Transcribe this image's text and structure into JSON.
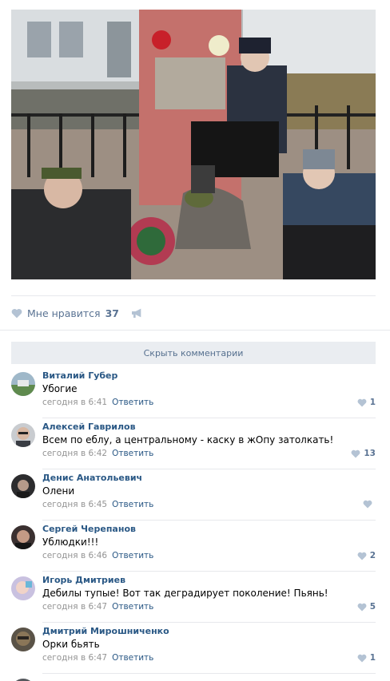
{
  "post": {
    "like_label": "Мне нравится",
    "like_count": "37",
    "hide_comments_label": "Скрыть комментарии"
  },
  "colors": {
    "link": "#2a5885",
    "muted": "#939393",
    "accent_soft": "#5a7393",
    "button_bg": "#eaedf1",
    "divider": "#e7e8ec"
  },
  "icons": {
    "like": "heart-icon",
    "share": "megaphone-icon",
    "comment_like": "heart-icon"
  },
  "comments": [
    {
      "author": "Виталий Губер",
      "text": "Убогие",
      "time": "сегодня в 6:41",
      "reply": "Ответить",
      "likes": "1"
    },
    {
      "author": "Алексей Гаврилов",
      "text": "Всем по еблу, а центральному - каску в жОпу затолкать!",
      "time": "сегодня в 6:42",
      "reply": "Ответить",
      "likes": "13"
    },
    {
      "author": "Денис Анатольевич",
      "text": "Олени",
      "time": "сегодня в 6:45",
      "reply": "Ответить",
      "likes": ""
    },
    {
      "author": "Сергей Черепанов",
      "text": "Ублюдки!!!",
      "time": "сегодня в 6:46",
      "reply": "Ответить",
      "likes": "2"
    },
    {
      "author": "Игорь Дмитриев",
      "text": "Дебилы тупые! Вот так деградирует поколение! Пьянь!",
      "time": "сегодня в 6:47",
      "reply": "Ответить",
      "likes": "5"
    },
    {
      "author": "Дмитрий Мирошниченко",
      "text": "Орки бьять",
      "time": "сегодня в 6:47",
      "reply": "Ответить",
      "likes": "1"
    }
  ]
}
